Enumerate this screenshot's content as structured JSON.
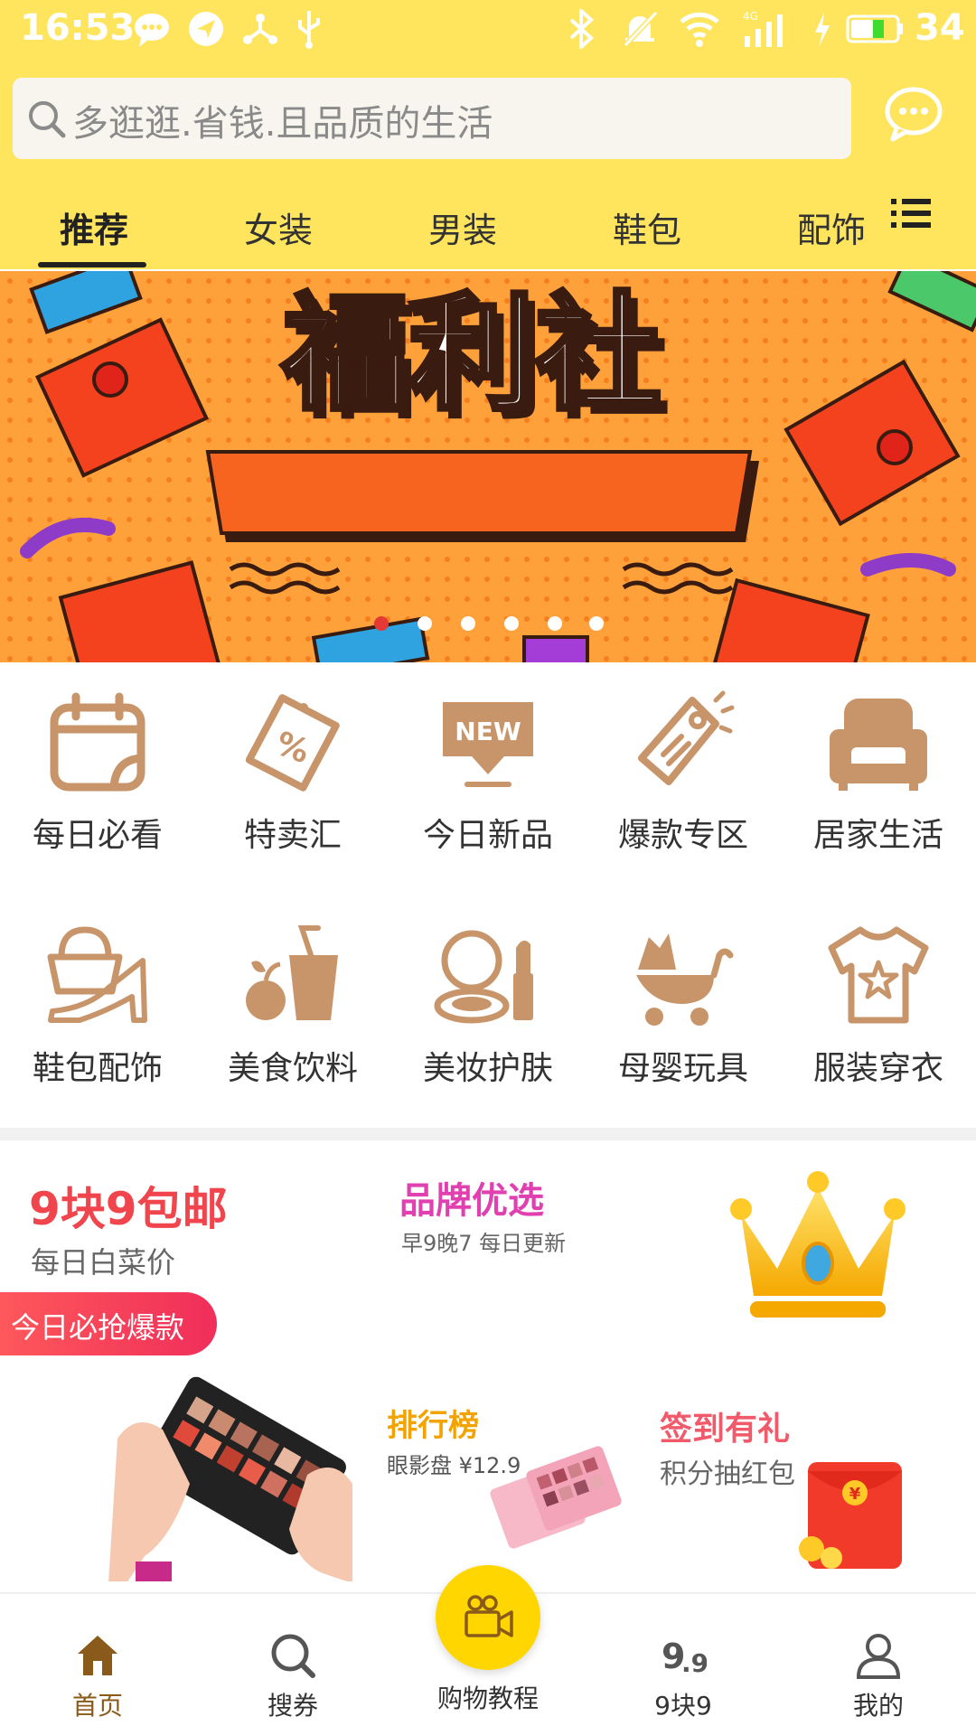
{
  "status_bar": {
    "time": "16:53",
    "battery": "34",
    "icons": [
      "chat-bubble-icon",
      "compass-icon",
      "share-icon",
      "usb-icon",
      "bluetooth-icon",
      "mute-icon",
      "wifi-icon",
      "signal-4g-icon",
      "charging-icon",
      "battery-icon"
    ]
  },
  "search": {
    "placeholder": "多逛逛.省钱.且品质的生活"
  },
  "tabs": [
    {
      "label": "推荐",
      "active": true
    },
    {
      "label": "女装",
      "active": false
    },
    {
      "label": "男装",
      "active": false
    },
    {
      "label": "鞋包",
      "active": false
    },
    {
      "label": "配饰",
      "active": false
    }
  ],
  "banner": {
    "title": "福利社",
    "dots": 6,
    "active_dot": 0
  },
  "categories": [
    {
      "label": "每日必看",
      "icon": "calendar-icon"
    },
    {
      "label": "特卖汇",
      "icon": "discount-tag-icon"
    },
    {
      "label": "今日新品",
      "icon": "new-badge-icon"
    },
    {
      "label": "爆款专区",
      "icon": "price-tag-icon"
    },
    {
      "label": "居家生活",
      "icon": "sofa-icon"
    },
    {
      "label": "鞋包配饰",
      "icon": "bag-shoe-icon"
    },
    {
      "label": "美食饮料",
      "icon": "food-drink-icon"
    },
    {
      "label": "美妆护肤",
      "icon": "cosmetics-icon"
    },
    {
      "label": "母婴玩具",
      "icon": "stroller-icon"
    },
    {
      "label": "服装穿衣",
      "icon": "tshirt-icon"
    }
  ],
  "promo": {
    "deal_title": "9块9包邮",
    "deal_sub": "每日白菜价",
    "brand_title": "品牌优选",
    "brand_sub": "早9晚7 每日更新",
    "hot_label": "今日必抢爆款",
    "rank_title": "排行榜",
    "rank_sub": "眼影盘 ¥12.9",
    "sign_title": "签到有礼",
    "sign_sub": "积分抽红包"
  },
  "bottom_nav": [
    {
      "label": "首页",
      "icon": "home-icon",
      "active": true
    },
    {
      "label": "搜券",
      "icon": "search-icon",
      "active": false
    },
    {
      "label": "购物教程",
      "icon": "video-camera-icon",
      "active": false
    },
    {
      "label": "9块9",
      "icon": "nine-nine-icon",
      "active": false
    },
    {
      "label": "我的",
      "icon": "user-icon",
      "active": false
    }
  ],
  "colors": {
    "header_yellow": "#FFE45E",
    "icon_tan": "#C8956A",
    "deal_red": "#F0454C",
    "brand_pink": "#E040B0",
    "fab_yellow": "#FFD600"
  }
}
